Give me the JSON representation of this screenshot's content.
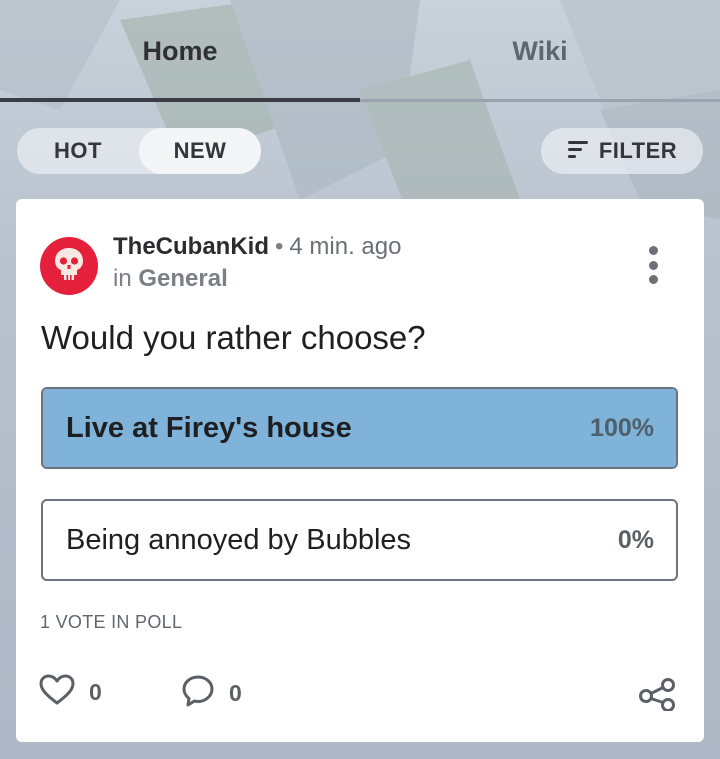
{
  "tabs": {
    "home": "Home",
    "wiki": "Wiki"
  },
  "sort": {
    "hot": "HOT",
    "new": "NEW",
    "active": "NEW"
  },
  "filter": {
    "label": "FILTER",
    "icon": "filter-icon"
  },
  "post": {
    "author": "TheCubanKid",
    "separator": "•",
    "time": "4 min. ago",
    "group_prefix": "in",
    "group": "General",
    "avatar_icon": "skull-icon",
    "question": "Would you rather choose?",
    "options": [
      {
        "label": "Live at Firey's house",
        "percent": "100%",
        "fill_fraction": 1.0
      },
      {
        "label": "Being annoyed by Bubbles",
        "percent": "0%",
        "fill_fraction": 0.0
      }
    ],
    "votes_text": "1 VOTE IN POLL",
    "likes": "0",
    "comments": "0"
  },
  "colors": {
    "accent": "#7fb3d9",
    "avatar": "#e4203a"
  }
}
